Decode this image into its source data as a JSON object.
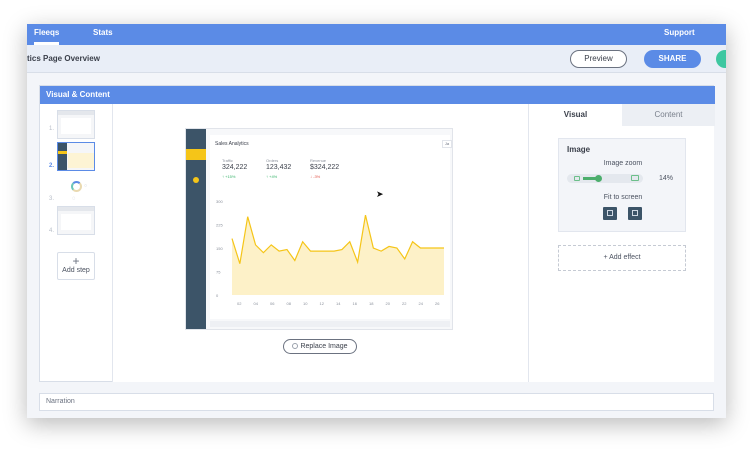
{
  "topnav": {
    "fleeqs": "Fleeqs",
    "stats": "Stats",
    "support": "Support"
  },
  "header": {
    "page_title": "tics Page Overview",
    "preview": "Preview",
    "share": "SHARE"
  },
  "panel": {
    "title": "Visual & Content"
  },
  "steps": {
    "items": [
      {
        "number": "1."
      },
      {
        "number": "2."
      },
      {
        "number": "3."
      },
      {
        "number": "4."
      }
    ],
    "add_step": "Add step"
  },
  "preview": {
    "app_title": "Sales Analytics",
    "tab_label": "Ja",
    "kpis": [
      {
        "label": "Traffic",
        "value": "324,222",
        "delta": "+15%",
        "direction": "up"
      },
      {
        "label": "Orders",
        "value": "123,432",
        "delta": "+4%",
        "direction": "up"
      },
      {
        "label": "Revenue",
        "value": "$324,222",
        "delta": "-3%",
        "direction": "down"
      }
    ],
    "chart_data": {
      "type": "area",
      "x": [
        "02",
        "04",
        "06",
        "08",
        "10",
        "12",
        "14",
        "16",
        "18",
        "20",
        "22",
        "24",
        "26"
      ],
      "y_ticks": [
        "0",
        "75",
        "150",
        "225",
        "300"
      ],
      "ylim": [
        0,
        300
      ],
      "values": [
        180,
        100,
        250,
        160,
        135,
        160,
        140,
        145,
        110,
        170,
        140,
        140,
        140,
        140,
        145,
        170,
        105,
        255,
        150,
        140,
        155,
        150,
        115,
        170,
        150,
        150,
        150,
        150
      ],
      "color": "#f5c518",
      "fill": "#fdf1c8"
    }
  },
  "replace_image": "Replace Image",
  "settings": {
    "tabs": {
      "visual": "Visual",
      "content": "Content"
    },
    "image_title": "Image",
    "zoom_label": "Image zoom",
    "zoom_value": "14%",
    "zoom_fraction": 0.14,
    "fit_label": "Fit to screen",
    "add_effect": "+ Add effect"
  },
  "narration": {
    "placeholder": "Narration"
  },
  "colors": {
    "brand": "#5b8be6",
    "accent_green": "#3ec7a0",
    "sidebar_dark": "#3c5468",
    "highlight_yellow": "#f5c518"
  }
}
